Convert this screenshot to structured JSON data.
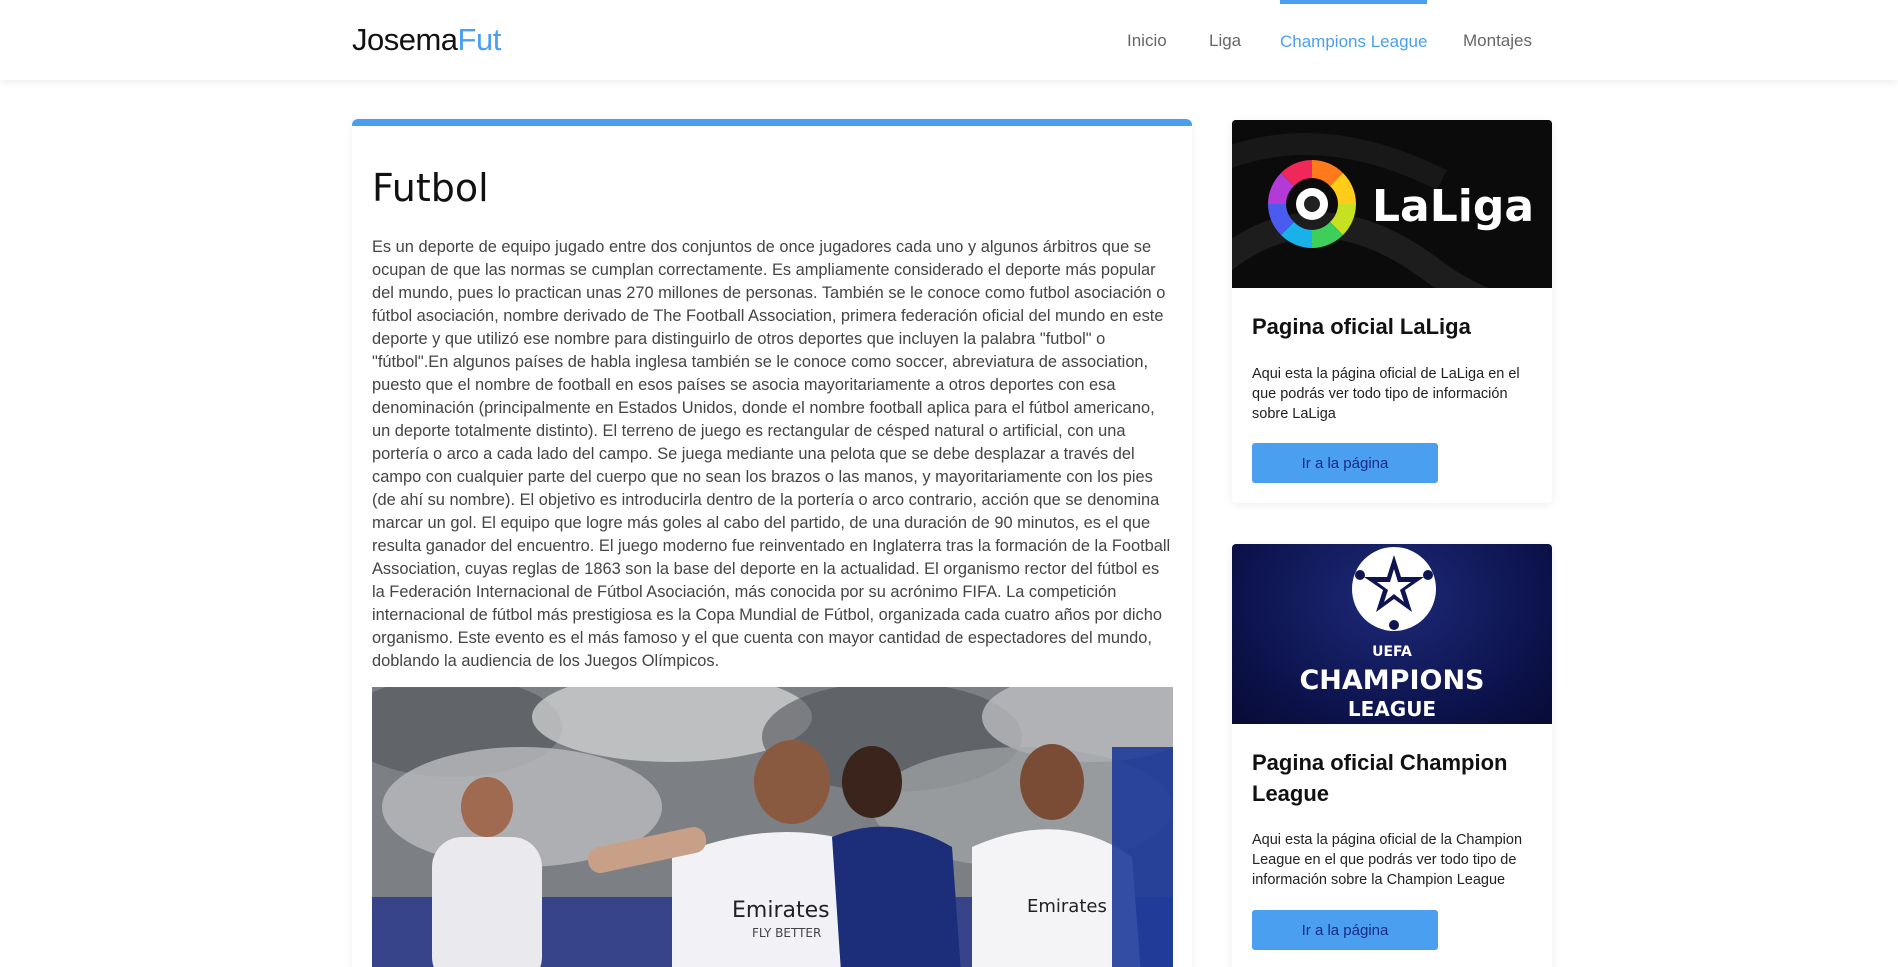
{
  "header": {
    "logo_main": "Josema",
    "logo_accent": "Fut",
    "nav": [
      {
        "label": "Inicio",
        "active": false
      },
      {
        "label": "Liga",
        "active": false
      },
      {
        "label": "Champions League",
        "active": true
      },
      {
        "label": "Montajes",
        "active": false
      }
    ]
  },
  "article": {
    "title": "Futbol",
    "body": "Es un deporte de equipo jugado entre dos conjuntos de once jugadores cada uno y algunos árbitros que se ocupan de que las normas se cumplan correctamente. Es ampliamente considerado el deporte más popular del mundo, pues lo practican unas 270 millones de personas. También se le conoce como futbol asociación o fútbol asociación, nombre derivado de The Football Association, primera federación oficial del mundo en este deporte y que utilizó ese nombre para distinguirlo de otros deportes que incluyen la palabra \"futbol\" o \"fútbol\".En algunos países de habla inglesa también se le conoce como soccer, abreviatura de association, puesto que el nombre de football en esos países se asocia mayoritariamente a otros deportes con esa denominación (principalmente en Estados Unidos, donde el nombre football aplica para el fútbol americano, un deporte totalmente distinto). El terreno de juego es rectangular de césped natural o artificial, con una portería o arco a cada lado del campo. Se juega mediante una pelota que se debe desplazar a través del campo con cualquier parte del cuerpo que no sean los brazos o las manos, y mayoritariamente con los pies (de ahí su nombre). El objetivo es introducirla dentro de la portería o arco contrario, acción que se denomina marcar un gol. El equipo que logre más goles al cabo del partido, de una duración de 90 minutos, es el que resulta ganador del encuentro. El juego moderno fue reinventado en Inglaterra tras la formación de la Football Association, cuyas reglas de 1863 son la base del deporte en la actualidad. El organismo rector del fútbol es la Federación Internacional de Fútbol Asociación, más conocida por su acrónimo FIFA. La competición internacional de fútbol más prestigiosa es la Copa Mundial de Fútbol, organizada cada cuatro años por dicho organismo. Este evento es el más famoso y el que cuenta con mayor cantidad de espectadores del mundo, doblando la audiencia de los Juegos Olímpicos.",
    "image_shirt_text_1": "Emirates",
    "image_shirt_text_2": "FLY BETTER"
  },
  "cards": [
    {
      "logo_text": "LaLiga",
      "title": "Pagina oficial LaLiga",
      "text": "Aqui esta la página oficial de LaLiga en el que podrás ver todo tipo de información sobre LaLiga",
      "button": "Ir a la página"
    },
    {
      "logo_small": "UEFA",
      "logo_main": "CHAMPIONS",
      "logo_sub": "LEAGUE",
      "title": "Pagina oficial Champion League",
      "text": "Aqui esta la página oficial de la Champion League en el que podrás ver todo tipo de información sobre la Champion League",
      "button": "Ir a la página"
    }
  ],
  "colors": {
    "accent": "#4a9ff0",
    "text": "#444444",
    "button_text": "#1a2a80"
  }
}
